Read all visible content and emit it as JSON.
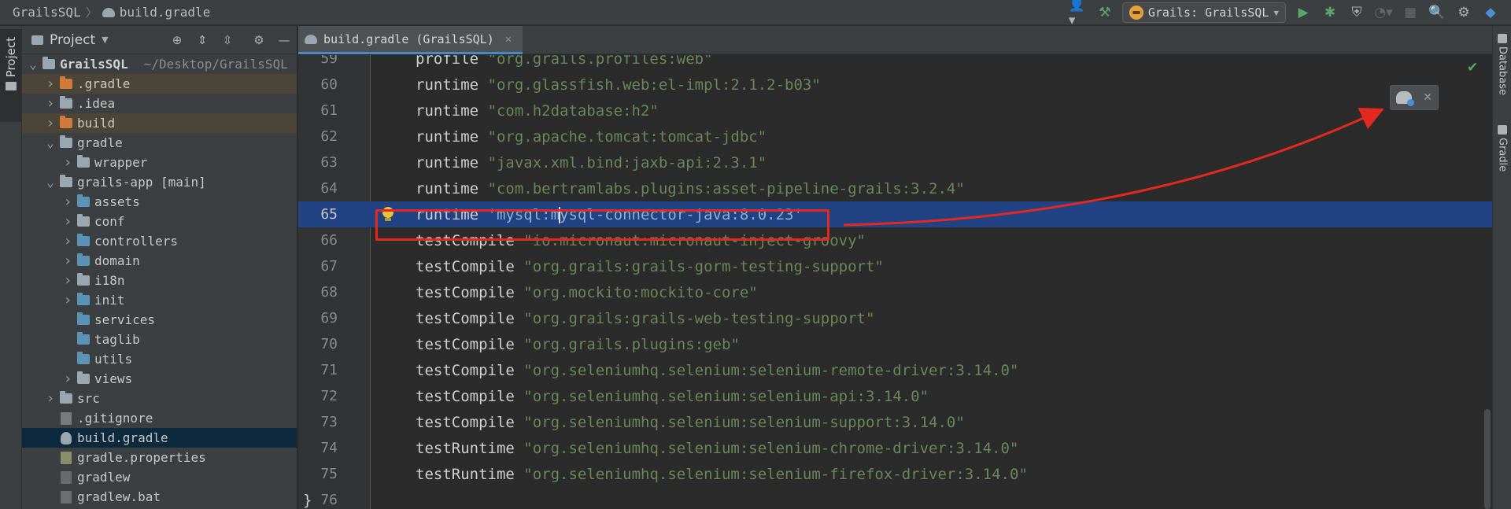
{
  "navbar": {
    "project": "GrailsSQL",
    "file": "build.gradle",
    "run_config": "Grails: GrailsSQL",
    "icons": [
      "user-icon",
      "hammer-icon",
      "run-icon",
      "debug-icon",
      "coverage-icon",
      "profile-icon",
      "stop-icon",
      "search-icon",
      "settings-icon",
      "plugin-icon"
    ]
  },
  "left_strip": {
    "project_label": "Project"
  },
  "project_panel": {
    "title": "Project",
    "tree": [
      {
        "name": "GrailsSQL",
        "path": "~/Desktop/GrailsSQL",
        "depth": 0,
        "expanded": true,
        "kind": "root"
      },
      {
        "name": ".gradle",
        "depth": 1,
        "expanded": false,
        "kind": "folder-orange",
        "highlight": true
      },
      {
        "name": ".idea",
        "depth": 1,
        "expanded": false,
        "kind": "folder-gray"
      },
      {
        "name": "build",
        "depth": 1,
        "expanded": false,
        "kind": "folder-orange",
        "highlight": true
      },
      {
        "name": "gradle",
        "depth": 1,
        "expanded": true,
        "kind": "folder-gray"
      },
      {
        "name": "wrapper",
        "depth": 2,
        "expanded": false,
        "kind": "folder-gray"
      },
      {
        "name": "grails-app [main]",
        "depth": 1,
        "expanded": true,
        "kind": "folder-mod"
      },
      {
        "name": "assets",
        "depth": 2,
        "expanded": false,
        "kind": "folder-blue"
      },
      {
        "name": "conf",
        "depth": 2,
        "expanded": false,
        "kind": "folder-mod"
      },
      {
        "name": "controllers",
        "depth": 2,
        "expanded": false,
        "kind": "folder-blue"
      },
      {
        "name": "domain",
        "depth": 2,
        "expanded": false,
        "kind": "folder-blue"
      },
      {
        "name": "i18n",
        "depth": 2,
        "expanded": false,
        "kind": "folder-mod"
      },
      {
        "name": "init",
        "depth": 2,
        "expanded": false,
        "kind": "folder-blue"
      },
      {
        "name": "services",
        "depth": 2,
        "expanded": null,
        "kind": "folder-blue"
      },
      {
        "name": "taglib",
        "depth": 2,
        "expanded": null,
        "kind": "folder-blue"
      },
      {
        "name": "utils",
        "depth": 2,
        "expanded": null,
        "kind": "folder-blue"
      },
      {
        "name": "views",
        "depth": 2,
        "expanded": false,
        "kind": "folder-mod"
      },
      {
        "name": "src",
        "depth": 1,
        "expanded": false,
        "kind": "folder-gray"
      },
      {
        "name": ".gitignore",
        "depth": 1,
        "expanded": null,
        "kind": "file-git"
      },
      {
        "name": "build.gradle",
        "depth": 1,
        "expanded": null,
        "kind": "file-gradle",
        "selected": true
      },
      {
        "name": "gradle.properties",
        "depth": 1,
        "expanded": null,
        "kind": "file-props"
      },
      {
        "name": "gradlew",
        "depth": 1,
        "expanded": null,
        "kind": "file-sh"
      },
      {
        "name": "gradlew.bat",
        "depth": 1,
        "expanded": null,
        "kind": "file-bat"
      }
    ]
  },
  "editor": {
    "tab_label": "build.gradle (GrailsSQL)",
    "active_line": 65,
    "lines": [
      {
        "num": "59",
        "kw": "profile",
        "str": "\"org.grails.profiles:web\""
      },
      {
        "num": "60",
        "kw": "runtime",
        "str": "\"org.glassfish.web:el-impl:2.1.2-b03\""
      },
      {
        "num": "61",
        "kw": "runtime",
        "str": "\"com.h2database:h2\""
      },
      {
        "num": "62",
        "kw": "runtime",
        "str": "\"org.apache.tomcat:tomcat-jdbc\""
      },
      {
        "num": "63",
        "kw": "runtime",
        "str": "\"javax.xml.bind:jaxb-api:2.3.1\""
      },
      {
        "num": "64",
        "kw": "runtime",
        "str": "\"com.bertramlabs.plugins:asset-pipeline-grails:3.2.4\""
      },
      {
        "num": "65",
        "kw": "runtime",
        "str_before_caret": "'mysql:m",
        "str_after_caret": "ysql-connector-java:8.0.23'"
      },
      {
        "num": "66",
        "kw": "testCompile",
        "str": "\"io.micronaut:micronaut-inject-groovy\""
      },
      {
        "num": "67",
        "kw": "testCompile",
        "str": "\"org.grails:grails-gorm-testing-support\""
      },
      {
        "num": "68",
        "kw": "testCompile",
        "str": "\"org.mockito:mockito-core\""
      },
      {
        "num": "69",
        "kw": "testCompile",
        "str": "\"org.grails:grails-web-testing-support\""
      },
      {
        "num": "70",
        "kw": "testCompile",
        "str": "\"org.grails.plugins:geb\""
      },
      {
        "num": "71",
        "kw": "testCompile",
        "str": "\"org.seleniumhq.selenium:selenium-remote-driver:3.14.0\""
      },
      {
        "num": "72",
        "kw": "testCompile",
        "str": "\"org.seleniumhq.selenium:selenium-api:3.14.0\""
      },
      {
        "num": "73",
        "kw": "testCompile",
        "str": "\"org.seleniumhq.selenium:selenium-support:3.14.0\""
      },
      {
        "num": "74",
        "kw": "testRuntime",
        "str": "\"org.seleniumhq.selenium:selenium-chrome-driver:3.14.0\""
      },
      {
        "num": "75",
        "kw": "testRuntime",
        "str": "\"org.seleniumhq.selenium:selenium-firefox-driver:3.14.0\""
      },
      {
        "num": "76",
        "kw": "}",
        "str": ""
      }
    ]
  },
  "right_strip": {
    "database_label": "Database",
    "gradle_label": "Gradle"
  },
  "colors": {
    "accent": "#4a88c7",
    "active_line": "#214283",
    "string": "#6a8759",
    "annotation": "#e3291f"
  }
}
